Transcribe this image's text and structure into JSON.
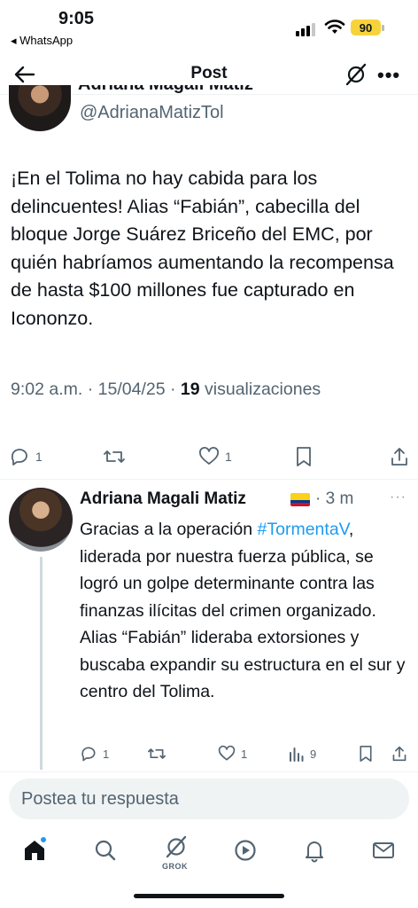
{
  "status_bar": {
    "time": "9:05",
    "back_app": "◂ WhatsApp",
    "battery": "90"
  },
  "nav": {
    "title": "Post"
  },
  "main_tweet": {
    "name_partial": "Adriana Magali Matiz",
    "handle": "@AdrianaMatizTol",
    "text": "¡En el  Tolima no hay cabida para los delincuentes! Alias “Fabián”, cabecilla del bloque Jorge Suárez Briceño del EMC, por quién habríamos aumentando la recompensa de hasta $100 millones fue capturado en Icononzo.",
    "time": "9:02 a.m.",
    "date": "15/04/25",
    "views_count": "19",
    "views_label": "visualizaciones",
    "sep": "·",
    "replies": "1",
    "likes": "1"
  },
  "reply": {
    "name": "Adriana Magali Matiz",
    "time": "3 m",
    "time_sep": "·",
    "more": "···",
    "text_before": "Gracias a la operación ",
    "hashtag": "#TormentaV",
    "text_after": ", liderada por  nuestra fuerza pública, se logró un golpe determinante contra las finanzas ilícitas del crimen organizado. Alias “Fabián” lideraba extorsiones y buscaba expandir su estructura en el sur y centro del Tolima.",
    "replies": "1",
    "likes": "1",
    "views": "9",
    "flag_colors": [
      "#fcd116",
      "#003893",
      "#ce1126"
    ]
  },
  "compose": {
    "placeholder": "Postea tu respuesta"
  },
  "tabbar": {
    "grok_label": "GROK"
  },
  "colors": {
    "accent": "#1d9bf0",
    "secondary_text": "#536471"
  }
}
